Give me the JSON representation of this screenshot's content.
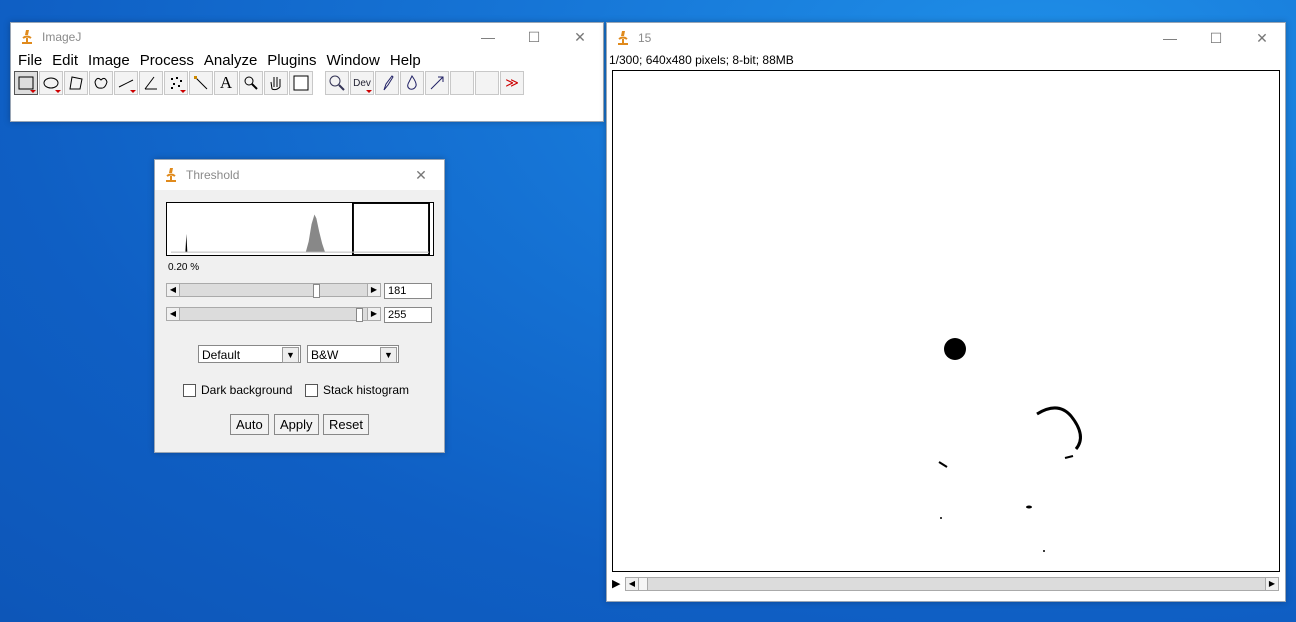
{
  "imagej": {
    "title": "ImageJ",
    "menu": [
      "File",
      "Edit",
      "Image",
      "Process",
      "Analyze",
      "Plugins",
      "Window",
      "Help"
    ],
    "tools": [
      "rectangle-tool",
      "oval-tool",
      "polygon-tool",
      "freehand-tool",
      "line-tool",
      "angle-tool",
      "point-tool",
      "wand-tool",
      "text-tool",
      "magnifier-tool",
      "hand-tool",
      "color-picker-tool",
      "gap",
      "zoom-tool",
      "dev-tool",
      "brush-tool",
      "drop-tool",
      "arrow-tool",
      "blank",
      "blank",
      "more-tools"
    ],
    "dev_label": "Dev",
    "more_label": "≫",
    "text_tool_label": "A"
  },
  "image_window": {
    "title": "15",
    "info": "1/300; 640x480 pixels; 8-bit; 88MB"
  },
  "threshold": {
    "title": "Threshold",
    "percent": "0.20 %",
    "min_value": "181",
    "max_value": "255",
    "method": "Default",
    "display": "B&W",
    "dark_background_label": "Dark background",
    "stack_histogram_label": "Stack histogram",
    "auto_label": "Auto",
    "apply_label": "Apply",
    "reset_label": "Reset",
    "min_slider_fraction": 0.71,
    "max_slider_fraction": 1.0
  },
  "colors": {
    "desktop": "#1675d6",
    "icon_orange": "#e08a1c"
  }
}
